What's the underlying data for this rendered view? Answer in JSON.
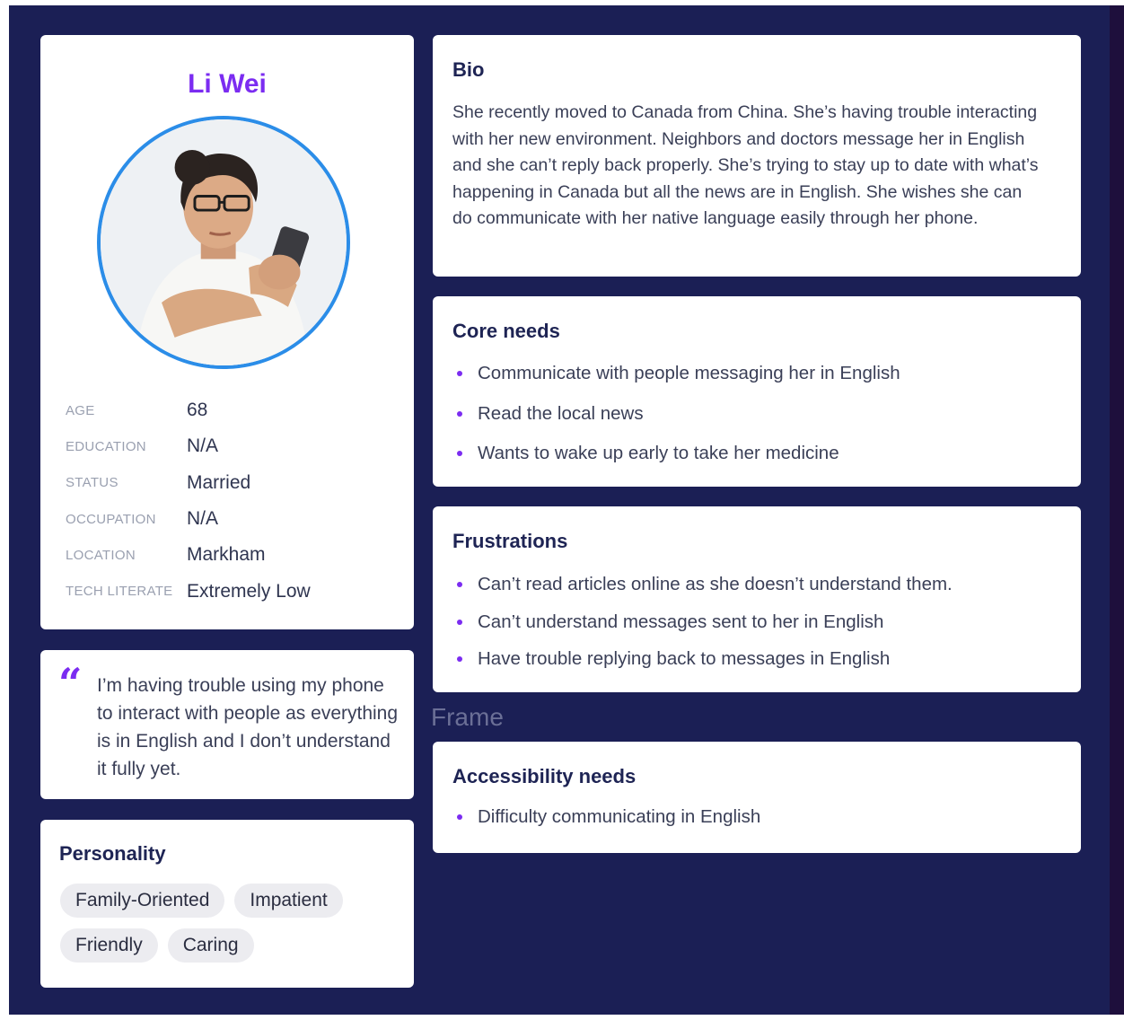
{
  "profile": {
    "name": "Li Wei",
    "facts": [
      {
        "label": "AGE",
        "value": "68"
      },
      {
        "label": "EDUCATION",
        "value": "N/A"
      },
      {
        "label": "STATUS",
        "value": "Married"
      },
      {
        "label": "OCCUPATION",
        "value": "N/A"
      },
      {
        "label": "LOCATION",
        "value": "Markham"
      },
      {
        "label": "TECH LITERATE",
        "value": "Extremely Low"
      }
    ]
  },
  "quote": {
    "mark": "“",
    "text": "I’m having trouble using my phone to interact with people as everything is in English and I don’t understand it fully yet."
  },
  "personality": {
    "title": "Personality",
    "tags": [
      "Family-Oriented",
      "Impatient",
      "Friendly",
      "Caring"
    ]
  },
  "bio": {
    "title": "Bio",
    "text": "She recently moved to Canada from China. She’s having trouble interacting with her new environment. Neighbors and doctors message her in English and she can’t reply back properly. She’s trying to stay up to date with what’s happening in Canada but all the news are in English. She wishes she can do communicate with her native language easily through her phone."
  },
  "core_needs": {
    "title": "Core needs",
    "items": [
      "Communicate with people messaging her in English",
      "Read the local news",
      "Wants to wake up early to take her medicine"
    ]
  },
  "frustrations": {
    "title": "Frustrations",
    "items": [
      "Can’t read articles online as she doesn’t understand them.",
      "Can’t understand messages sent to her in English",
      "Have trouble replying back to messages in English"
    ]
  },
  "frame_label": "Frame",
  "accessibility_needs": {
    "title": "Accessibility needs",
    "items": [
      "Difficulty communicating in English"
    ]
  },
  "colors": {
    "background": "#1b1f55",
    "accent": "#7b2cf1",
    "avatar_ring": "#2b8de8"
  }
}
